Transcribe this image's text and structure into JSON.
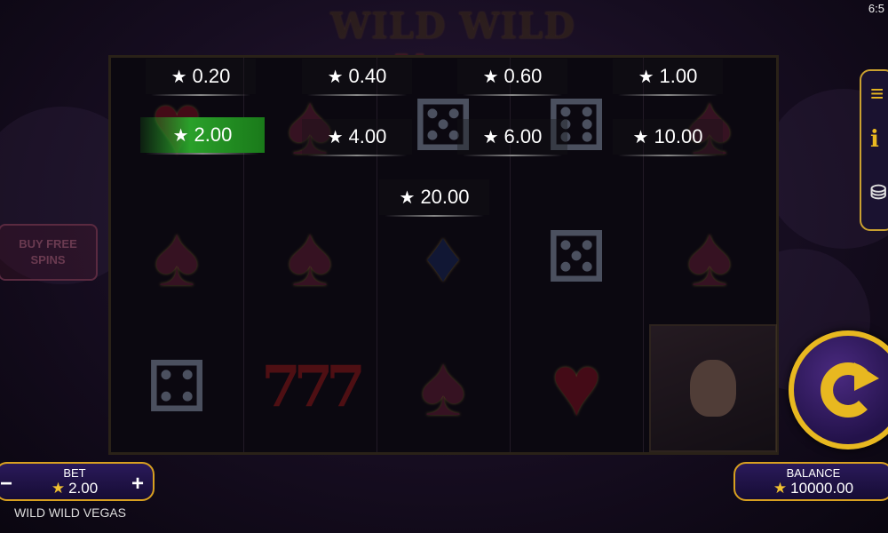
{
  "status": {
    "time": "6:5"
  },
  "logo": {
    "wild": "WILD WILD ",
    "vegas": "Vegas"
  },
  "bet_options": [
    {
      "value": "0.20",
      "selected": false
    },
    {
      "value": "0.40",
      "selected": false
    },
    {
      "value": "0.60",
      "selected": false
    },
    {
      "value": "1.00",
      "selected": false
    },
    {
      "value": "2.00",
      "selected": true
    },
    {
      "value": "4.00",
      "selected": false
    },
    {
      "value": "6.00",
      "selected": false
    },
    {
      "value": "10.00",
      "selected": false
    },
    {
      "value": "20.00",
      "selected": false
    }
  ],
  "buy_free_spins": "BUY FREE SPINS",
  "side_icons": [
    "menu-icon",
    "info-icon",
    "coins-icon"
  ],
  "bet": {
    "label": "BET",
    "value": "2.00",
    "minus": "−",
    "plus": "+"
  },
  "balance": {
    "label": "BALANCE",
    "value": "10000.00"
  },
  "game_title": "WILD WILD VEGAS",
  "reels_symbols": [
    [
      "heart",
      "spade",
      "dice"
    ],
    [
      "spade",
      "spade",
      "seven"
    ],
    [
      "dice",
      "diamond",
      "spade"
    ],
    [
      "dice",
      "dice",
      "heart"
    ],
    [
      "spade",
      "spade",
      "portrait"
    ]
  ],
  "colors": {
    "accent": "#e8b820",
    "selected": "#2aa02a",
    "panel": "#1a1230"
  }
}
